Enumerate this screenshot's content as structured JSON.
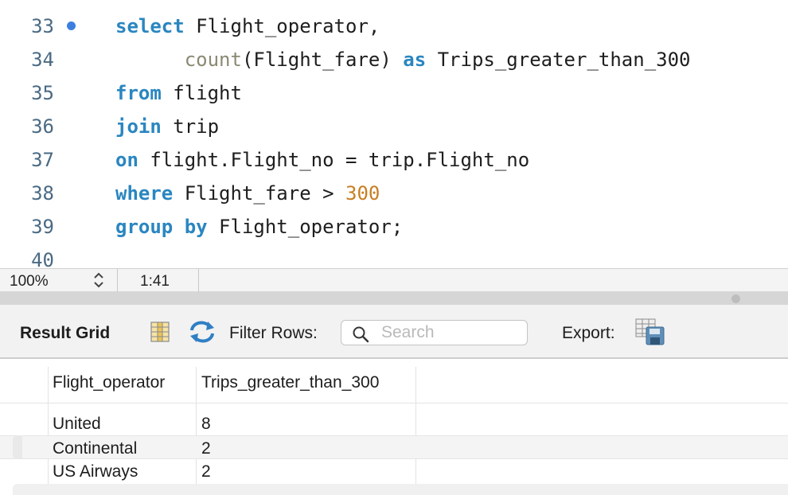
{
  "editor": {
    "lines": [
      {
        "num": "33",
        "segments": [
          {
            "t": "select",
            "c": "kw"
          },
          {
            "t": " Flight_operator,",
            "c": ""
          }
        ],
        "marker": true
      },
      {
        "num": "34",
        "segments": [
          {
            "t": "      ",
            "c": ""
          },
          {
            "t": "count",
            "c": "fn"
          },
          {
            "t": "(Flight_fare) ",
            "c": ""
          },
          {
            "t": "as",
            "c": "kw"
          },
          {
            "t": " Trips_greater_than_300",
            "c": ""
          }
        ]
      },
      {
        "num": "35",
        "segments": [
          {
            "t": "from",
            "c": "kw"
          },
          {
            "t": " flight",
            "c": ""
          }
        ]
      },
      {
        "num": "36",
        "segments": [
          {
            "t": "join",
            "c": "kw"
          },
          {
            "t": " trip",
            "c": ""
          }
        ]
      },
      {
        "num": "37",
        "segments": [
          {
            "t": "on",
            "c": "kw"
          },
          {
            "t": " flight.Flight_no = trip.Flight_no",
            "c": ""
          }
        ]
      },
      {
        "num": "38",
        "segments": [
          {
            "t": "where",
            "c": "kw"
          },
          {
            "t": " Flight_fare > ",
            "c": ""
          },
          {
            "t": "300",
            "c": "num"
          }
        ]
      },
      {
        "num": "39",
        "segments": [
          {
            "t": "group by",
            "c": "kw"
          },
          {
            "t": " Flight_operator;",
            "c": ""
          }
        ]
      },
      {
        "num": "40",
        "segments": []
      }
    ]
  },
  "status_bar": {
    "zoom": "100%",
    "cursor_position": "1:41"
  },
  "result_panel": {
    "title": "Result Grid",
    "filter_label": "Filter Rows:",
    "search_placeholder": "Search",
    "search_value": "",
    "export_label": "Export:",
    "icons": {
      "grid_toggle": "grid-layout-icon",
      "refresh": "refresh-icon",
      "search": "search-icon",
      "export": "export-save-icon"
    }
  },
  "grid": {
    "columns": [
      "Flight_operator",
      "Trips_greater_than_300"
    ],
    "rows": [
      [
        "United",
        "8"
      ],
      [
        "Continental",
        "2"
      ],
      [
        "US Airways",
        "2"
      ]
    ]
  },
  "colors": {
    "keyword": "#2a86c0",
    "function": "#8a8a74",
    "number": "#c97e22",
    "marker": "#3d7fe0"
  }
}
